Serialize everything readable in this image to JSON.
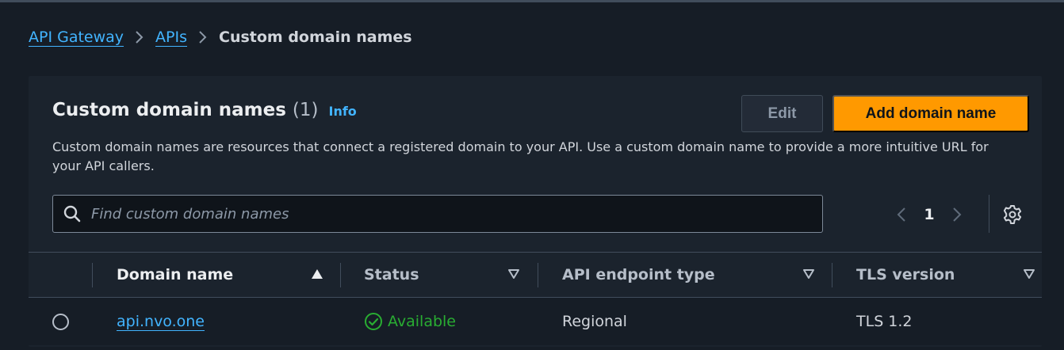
{
  "breadcrumb": {
    "items": [
      "API Gateway",
      "APIs"
    ],
    "current": "Custom domain names"
  },
  "panel": {
    "title": "Custom domain names",
    "count": "(1)",
    "info_label": "Info",
    "description": "Custom domain names are resources that connect a registered domain to your API. Use a custom domain name to provide a more intuitive URL for your API callers.",
    "edit_label": "Edit",
    "add_label": "Add domain name"
  },
  "search": {
    "placeholder": "Find custom domain names",
    "value": ""
  },
  "pagination": {
    "current_page": "1"
  },
  "table": {
    "columns": [
      "Domain name",
      "Status",
      "API endpoint type",
      "TLS version"
    ],
    "rows": [
      {
        "domain_name": "api.nvo.one",
        "status": "Available",
        "endpoint_type": "Regional",
        "tls_version": "TLS 1.2"
      }
    ]
  },
  "colors": {
    "accent": "#ff9900",
    "link": "#42b4ff",
    "success": "#29ad32",
    "background": "#161d26",
    "panel": "#1b232d"
  },
  "icons": {
    "separator": "chevron-right-icon",
    "search": "search-icon",
    "settings": "gear-icon",
    "status": "check-circle-icon",
    "sort_asc": "sort-ascending-icon",
    "sort": "sort-icon"
  }
}
